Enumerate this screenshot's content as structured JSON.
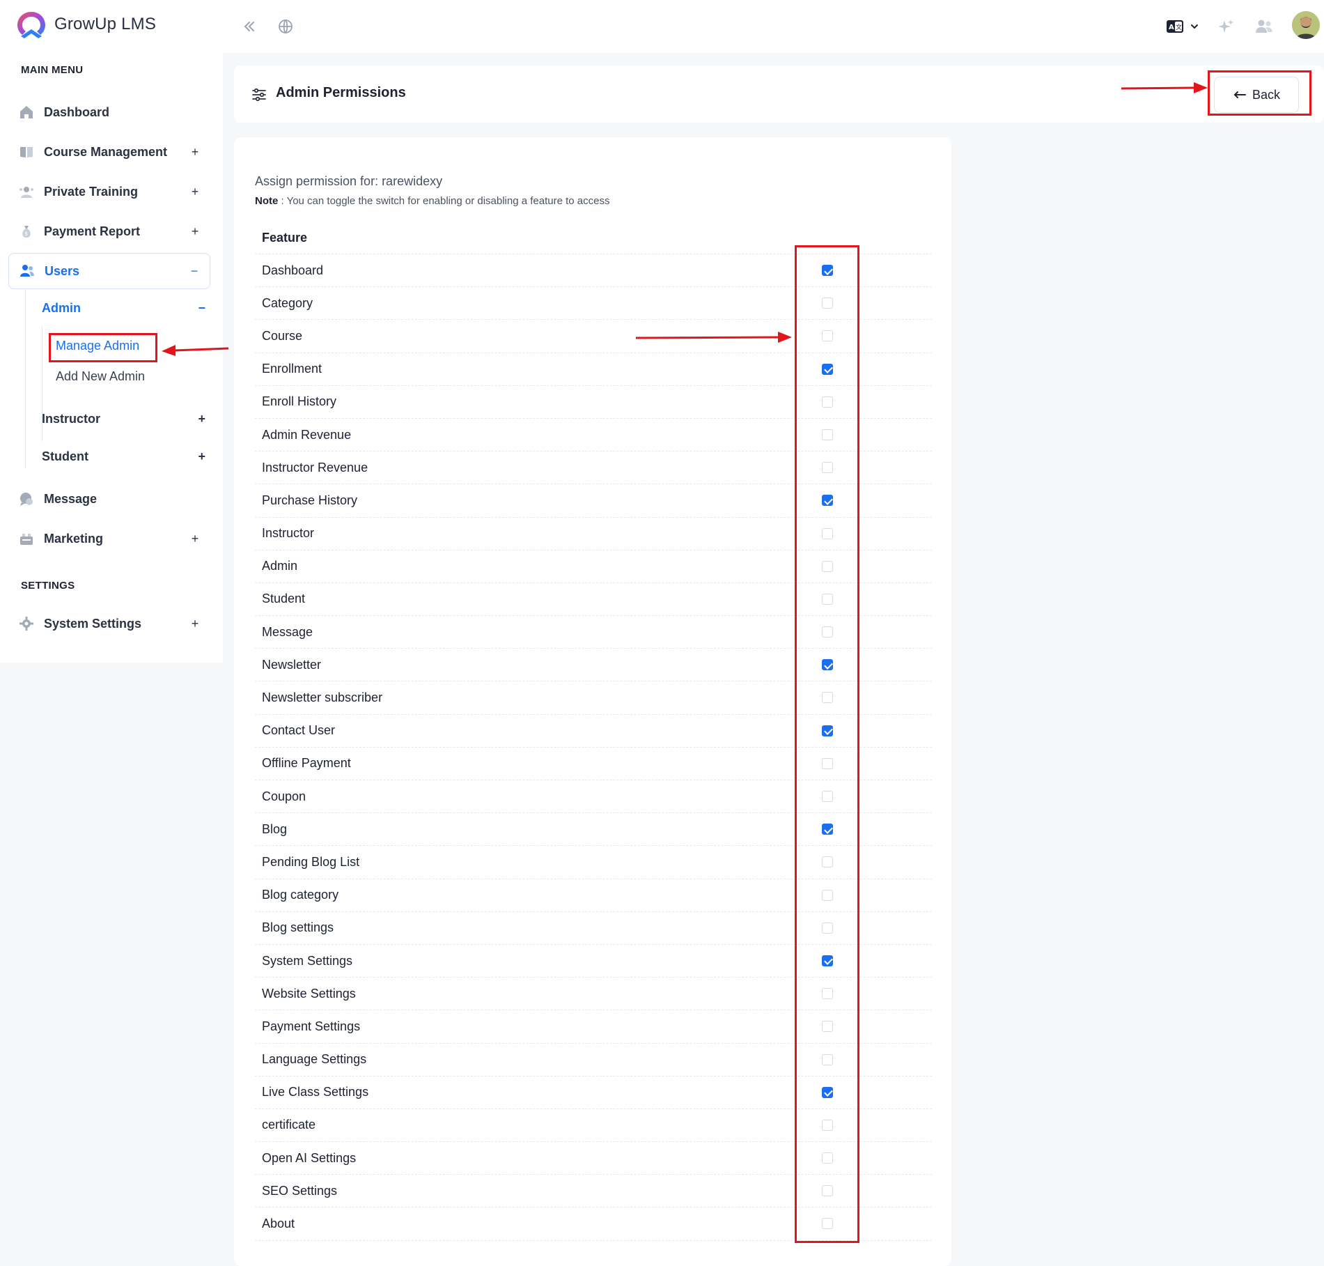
{
  "app": {
    "name": "GrowUp LMS"
  },
  "topbar": {
    "lang_icon": "language-icon",
    "lang_badge": "A",
    "lang_badge_alt": "文"
  },
  "sidebar": {
    "main_menu_heading": "MAIN MENU",
    "settings_heading": "SETTINGS",
    "items": [
      {
        "label": "Dashboard",
        "icon": "home-icon",
        "toggle": ""
      },
      {
        "label": "Course Management",
        "icon": "book-icon",
        "toggle": "+"
      },
      {
        "label": "Private Training",
        "icon": "trainer-icon",
        "toggle": "+"
      },
      {
        "label": "Payment Report",
        "icon": "money-bag-icon",
        "toggle": "+"
      },
      {
        "label": "Users",
        "icon": "users-icon",
        "toggle": "−"
      },
      {
        "label": "Message",
        "icon": "chat-icon",
        "toggle": ""
      },
      {
        "label": "Marketing",
        "icon": "marketing-icon",
        "toggle": "+"
      },
      {
        "label": "System Settings",
        "icon": "gear-icon",
        "toggle": "+"
      }
    ],
    "users_sub": [
      {
        "label": "Admin",
        "toggle": "−"
      },
      {
        "label": "Instructor",
        "toggle": "+"
      },
      {
        "label": "Student",
        "toggle": "+"
      }
    ],
    "admin_leaves": [
      {
        "label": "Manage Admin"
      },
      {
        "label": "Add New Admin"
      }
    ]
  },
  "header": {
    "title": "Admin Permissions",
    "back_label": "Back"
  },
  "permissions": {
    "assign_text": "Assign permission for: rarewidexy",
    "note_label": "Note",
    "note_text": " : You can toggle the switch for enabling or disabling a feature to access",
    "column_header": "Feature",
    "features": [
      {
        "name": "Dashboard",
        "enabled": true
      },
      {
        "name": "Category",
        "enabled": false
      },
      {
        "name": "Course",
        "enabled": false
      },
      {
        "name": "Enrollment",
        "enabled": true
      },
      {
        "name": "Enroll History",
        "enabled": false
      },
      {
        "name": "Admin Revenue",
        "enabled": false
      },
      {
        "name": "Instructor Revenue",
        "enabled": false
      },
      {
        "name": "Purchase History",
        "enabled": true
      },
      {
        "name": "Instructor",
        "enabled": false
      },
      {
        "name": "Admin",
        "enabled": false
      },
      {
        "name": "Student",
        "enabled": false
      },
      {
        "name": "Message",
        "enabled": false
      },
      {
        "name": "Newsletter",
        "enabled": true
      },
      {
        "name": "Newsletter subscriber",
        "enabled": false
      },
      {
        "name": "Contact User",
        "enabled": true
      },
      {
        "name": "Offline Payment",
        "enabled": false
      },
      {
        "name": "Coupon",
        "enabled": false
      },
      {
        "name": "Blog",
        "enabled": true
      },
      {
        "name": "Pending Blog List",
        "enabled": false
      },
      {
        "name": "Blog category",
        "enabled": false
      },
      {
        "name": "Blog settings",
        "enabled": false
      },
      {
        "name": "System Settings",
        "enabled": true
      },
      {
        "name": "Website Settings",
        "enabled": false
      },
      {
        "name": "Payment Settings",
        "enabled": false
      },
      {
        "name": "Language Settings",
        "enabled": false
      },
      {
        "name": "Live Class Settings",
        "enabled": true
      },
      {
        "name": "certificate",
        "enabled": false
      },
      {
        "name": "Open AI Settings",
        "enabled": false
      },
      {
        "name": "SEO Settings",
        "enabled": false
      },
      {
        "name": "About",
        "enabled": false
      }
    ]
  },
  "colors": {
    "accent": "#1a6ff0",
    "annotation": "#e4141b"
  }
}
